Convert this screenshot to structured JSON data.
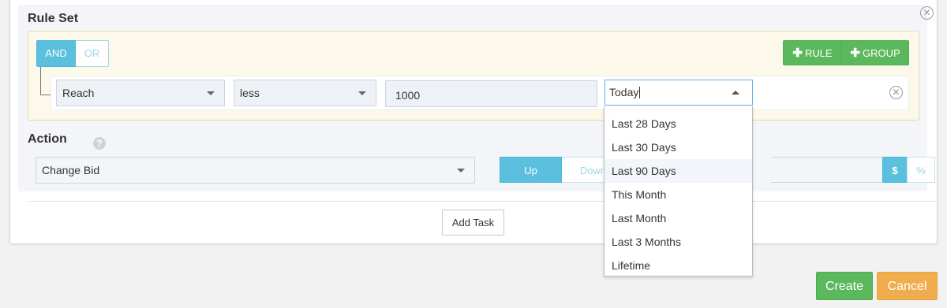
{
  "rule_set": {
    "title": "Rule Set",
    "conditions": {
      "and_label": "AND",
      "or_label": "OR",
      "selected": "AND"
    },
    "add_rule_label": "RULE",
    "add_group_label": "GROUP",
    "rule": {
      "metric": "Reach",
      "operator": "less",
      "value": "1000",
      "date_range": "Today"
    },
    "date_options": [
      "Last 28 Days",
      "Last 30 Days",
      "Last 90 Days",
      "This Month",
      "Last Month",
      "Last 3 Months",
      "Lifetime"
    ],
    "highlighted_option": "Last 90 Days"
  },
  "action": {
    "title": "Action",
    "help_glyph": "?",
    "type": "Change Bid",
    "up_label": "Up",
    "down_label": "Down",
    "selected_direction": "Up",
    "dollar_label": "$",
    "percent_label": "%",
    "selected_unit": "$"
  },
  "add_task_label": "Add Task",
  "footer": {
    "create_label": "Create",
    "cancel_label": "Cancel"
  },
  "colors": {
    "accent_blue": "#5bc0de",
    "success_green": "#5cb85c",
    "warning_orange": "#f0ad4e",
    "rules_box_bg": "#fcf8ea"
  },
  "icons": {
    "close": "close-icon",
    "plus": "plus-icon",
    "caret": "chevron-down-icon",
    "help": "help-icon"
  }
}
